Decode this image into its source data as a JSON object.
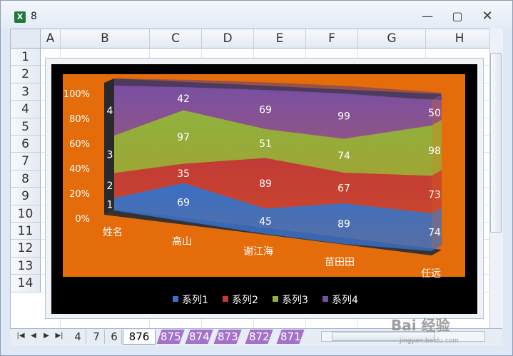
{
  "window": {
    "title": "8"
  },
  "columns": [
    "A",
    "B",
    "C",
    "D",
    "E",
    "F",
    "G",
    "H"
  ],
  "rows": [
    "1",
    "2",
    "3",
    "4",
    "5",
    "6",
    "7",
    "8",
    "9",
    "10",
    "11",
    "12",
    "13",
    "14"
  ],
  "sheet_tabs": {
    "plain": [
      "4",
      "7",
      "6"
    ],
    "active": "876",
    "purple": [
      "875",
      "874",
      "873",
      "872",
      "871"
    ]
  },
  "watermark": {
    "text": "Bai 经验",
    "url": "jingyan.baidu.com"
  },
  "chart_data": {
    "type": "area",
    "stacking": "percent",
    "categories": [
      "姓名",
      "高山",
      "谢江海",
      "苗田田",
      "任远"
    ],
    "y_ticks": [
      "0%",
      "20%",
      "40%",
      "60%",
      "80%",
      "100%"
    ],
    "ylim": [
      0,
      100
    ],
    "legend_position": "bottom",
    "series": [
      {
        "name": "系列1",
        "values": [
          1,
          69,
          45,
          89,
          74
        ],
        "color": "#3a6fc4"
      },
      {
        "name": "系列2",
        "values": [
          2,
          35,
          89,
          67,
          73
        ],
        "color": "#c23b36"
      },
      {
        "name": "系列3",
        "values": [
          3,
          97,
          51,
          74,
          98
        ],
        "color": "#8fb23e"
      },
      {
        "name": "系列4",
        "values": [
          4,
          42,
          69,
          99,
          50
        ],
        "color": "#7a4fa3"
      }
    ],
    "background": "#e46c0a",
    "outer_background": "#000000"
  }
}
